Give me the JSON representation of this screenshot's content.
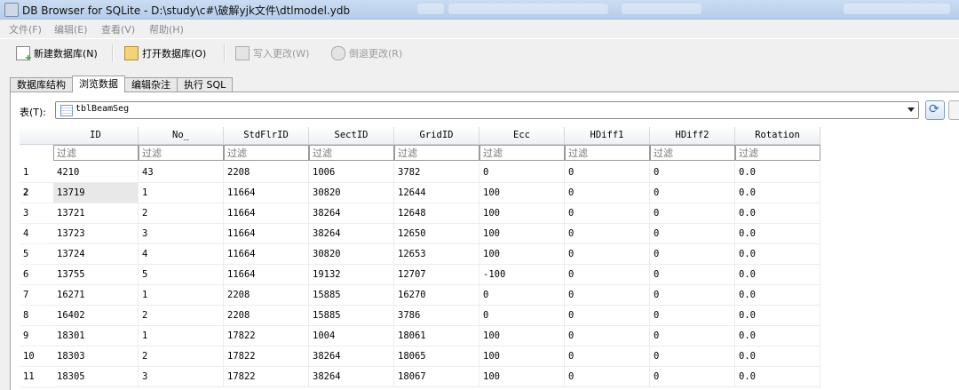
{
  "window": {
    "title": "DB Browser for SQLite - D:\\study\\c#\\破解yjk文件\\dtlmodel.ydb"
  },
  "menu": [
    {
      "label": "文件(F)"
    },
    {
      "label": "编辑(E)"
    },
    {
      "label": "查看(V)"
    },
    {
      "label": "帮助(H)"
    }
  ],
  "toolbar": {
    "new_db": "新建数据库(N)",
    "open_db": "打开数据库(O)",
    "write_changes": "写入更改(W)",
    "revert_changes": "倒退更改(R)"
  },
  "tabs": [
    {
      "label": "数据库结构"
    },
    {
      "label": "浏览数据"
    },
    {
      "label": "编辑杂注"
    },
    {
      "label": "执行 SQL"
    }
  ],
  "active_tab": 1,
  "browse": {
    "table_label": "表(T):",
    "table_value": "tblBeamSeg",
    "filter_placeholder": "过滤",
    "columns": [
      "ID",
      "No_",
      "StdFlrID",
      "SectID",
      "GridID",
      "Ecc",
      "HDiff1",
      "HDiff2",
      "Rotation"
    ],
    "rows": [
      {
        "num": "1",
        "cells": [
          "4210",
          "43",
          "2208",
          "1006",
          "3782",
          "0",
          "0",
          "0",
          "0.0"
        ]
      },
      {
        "num": "2",
        "cells": [
          "13719",
          "1",
          "11664",
          "30820",
          "12644",
          "100",
          "0",
          "0",
          "0.0"
        ]
      },
      {
        "num": "3",
        "cells": [
          "13721",
          "2",
          "11664",
          "38264",
          "12648",
          "100",
          "0",
          "0",
          "0.0"
        ]
      },
      {
        "num": "4",
        "cells": [
          "13723",
          "3",
          "11664",
          "38264",
          "12650",
          "100",
          "0",
          "0",
          "0.0"
        ]
      },
      {
        "num": "5",
        "cells": [
          "13724",
          "4",
          "11664",
          "30820",
          "12653",
          "100",
          "0",
          "0",
          "0.0"
        ]
      },
      {
        "num": "6",
        "cells": [
          "13755",
          "5",
          "11664",
          "19132",
          "12707",
          "-100",
          "0",
          "0",
          "0.0"
        ]
      },
      {
        "num": "7",
        "cells": [
          "16271",
          "1",
          "2208",
          "15885",
          "16270",
          "0",
          "0",
          "0",
          "0.0"
        ]
      },
      {
        "num": "8",
        "cells": [
          "16402",
          "2",
          "2208",
          "15885",
          "3786",
          "0",
          "0",
          "0",
          "0.0"
        ]
      },
      {
        "num": "9",
        "cells": [
          "18301",
          "1",
          "17822",
          "1004",
          "18061",
          "100",
          "0",
          "0",
          "0.0"
        ]
      },
      {
        "num": "10",
        "cells": [
          "18303",
          "2",
          "17822",
          "38264",
          "18065",
          "100",
          "0",
          "0",
          "0.0"
        ]
      },
      {
        "num": "11",
        "cells": [
          "18305",
          "3",
          "17822",
          "38264",
          "18067",
          "100",
          "0",
          "0",
          "0.0"
        ]
      }
    ]
  }
}
